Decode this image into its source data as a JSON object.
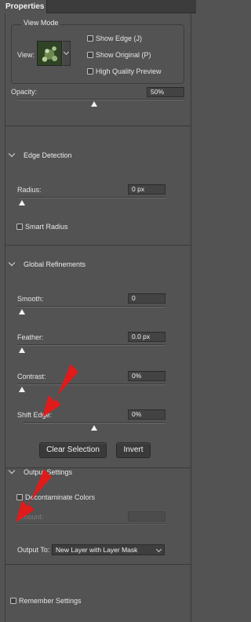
{
  "panel": {
    "tab_label": "Properties"
  },
  "view_mode": {
    "group_label": "View Mode",
    "view_label": "View:",
    "thumbnail_icon": "succulent-thumbnail",
    "options": [
      {
        "label": "Show Edge (J)",
        "checked": false
      },
      {
        "label": "Show Original (P)",
        "checked": false
      },
      {
        "label": "High Quality Preview",
        "checked": false
      }
    ]
  },
  "opacity": {
    "label": "Opacity:",
    "value": "50%",
    "slider_level": 0.5
  },
  "edge_detection": {
    "title": "Edge Detection",
    "radius": {
      "label": "Radius:",
      "value": "0 px",
      "slider_level": 0.0
    },
    "smart_radius": {
      "label": "Smart Radius",
      "checked": false
    }
  },
  "global_refinements": {
    "title": "Global Refinements",
    "smooth": {
      "label": "Smooth:",
      "value": "0",
      "slider_level": 0.0
    },
    "feather": {
      "label": "Feather:",
      "value": "0.0 px",
      "slider_level": 0.0
    },
    "contrast": {
      "label": "Contrast:",
      "value": "0%",
      "slider_level": 0.0
    },
    "shift_edge": {
      "label": "Shift Edge:",
      "value": "0%",
      "slider_level": 0.5
    },
    "clear_selection_label": "Clear Selection",
    "invert_label": "Invert"
  },
  "output_settings": {
    "title": "Output Settings",
    "decontaminate": {
      "label": "Decontaminate Colors",
      "checked": false
    },
    "amount": {
      "label": "Amount:",
      "value": ""
    },
    "output_to": {
      "label": "Output To:",
      "selected": "New Layer with Layer Mask"
    }
  },
  "remember_settings": {
    "label": "Remember Settings",
    "checked": false
  },
  "colors": {
    "panel_bg": "#535353",
    "annotation_arrow": "#e01b1b"
  }
}
